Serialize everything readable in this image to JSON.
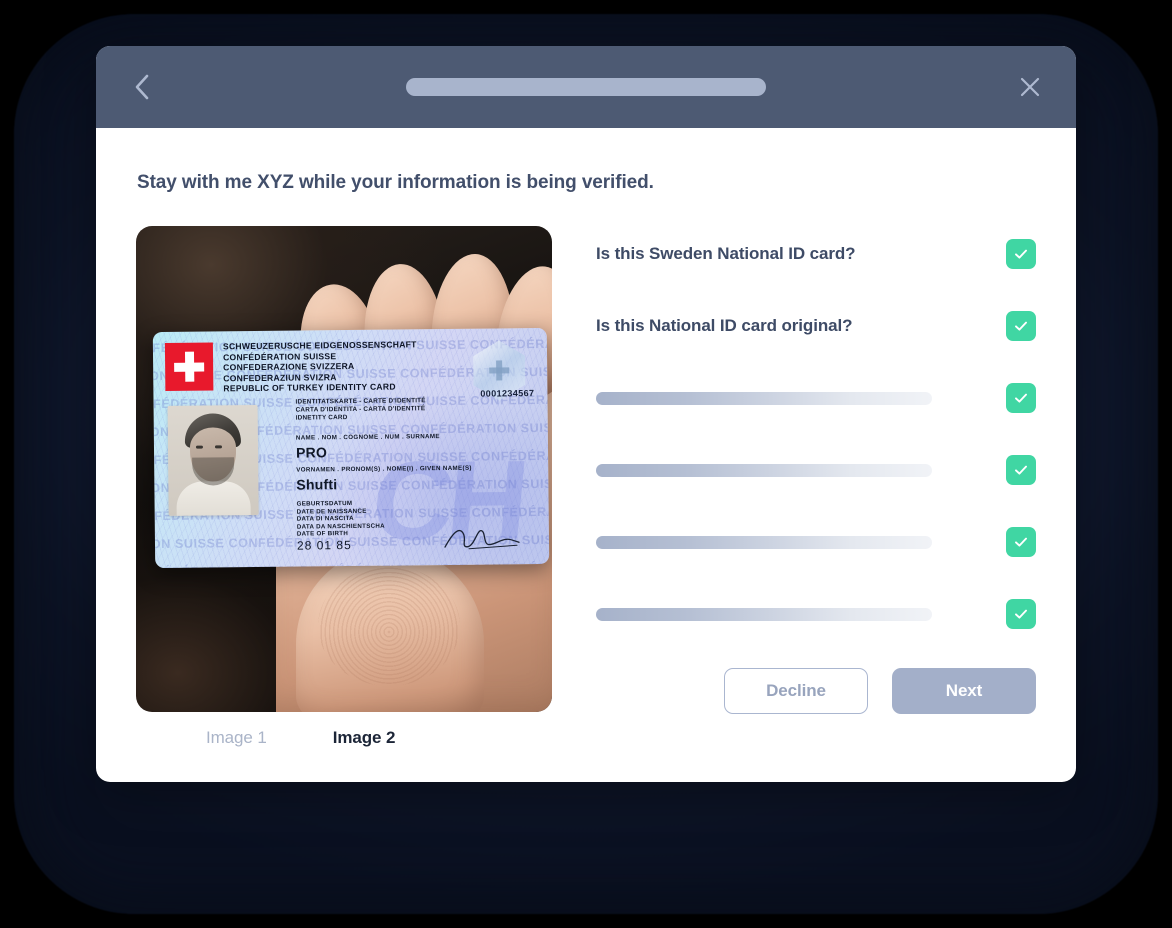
{
  "window": {
    "frame_color": "#131c33",
    "background_color": "#000000"
  },
  "header": {
    "back_icon": "chevron-left-icon",
    "close_icon": "close-x-icon",
    "bar_color": "#4d5a73",
    "progress_color": "#a8b4cc",
    "progress_value": ""
  },
  "main": {
    "headline": "Stay with me XYZ while your information is being verified."
  },
  "photo": {
    "alt": "Hand holding a national ID card",
    "card": {
      "titles": [
        "SCHWEUZERUSCHE EIDGENOSSENSCHAFT",
        "CONFÉDÉRATION SUISSE",
        "CONFEDERAZIONE SVIZZERA",
        "CONFEDERAZIUN SVIZRA",
        "REPUBLIC OF TURKEY IDENTITY CARD"
      ],
      "subtitles": [
        "IDENTITATSKARTE - CARTE D'IDENTITÉ",
        "CARTA D'IDENTITA - CARTA D'IDENTITÉ",
        "IDNETITY CARD"
      ],
      "serial": "0001234567",
      "surname_label": "NAME . NOM . COGNOME . NUM . SURNAME",
      "surname_value": "PRO",
      "given_label": "VORNAMEN .  PRONOM(S) .  NOME(I) .  GIVEN NAME(S)",
      "given_value": "Shufti",
      "dob_label": "GEBURTSDATUM\nDATE DE NAISSANCE\nDATA DI NASCITA\nDATA DA NASCHIENTSCHA\nDATE OF BIRTH",
      "dob_value": "28 01 85",
      "watermark_text": "CONFÉDÉRATION SUISSE   CONFÉDÉRATION SUISSE   CONFÉDÉRATION SUISSE   CONFÉ",
      "big_mark": "CH"
    }
  },
  "tabs": [
    {
      "label": "Image 1",
      "active": false
    },
    {
      "label": "Image 2",
      "active": true
    }
  ],
  "checks": [
    {
      "label": "Is this Sweden National ID card?",
      "type": "text",
      "checked": true
    },
    {
      "label": "Is this National ID card original?",
      "type": "text",
      "checked": true
    },
    {
      "label": "",
      "type": "skeleton",
      "checked": true
    },
    {
      "label": "",
      "type": "skeleton",
      "checked": true
    },
    {
      "label": "",
      "type": "skeleton",
      "checked": true
    },
    {
      "label": "",
      "type": "skeleton",
      "checked": true
    }
  ],
  "buttons": {
    "decline": "Decline",
    "next": "Next",
    "decline_color": "#98a4bd",
    "next_color": "#a3afc9"
  },
  "colors": {
    "check_green": "#40d6a3",
    "text_dark": "#3e4b66",
    "skeleton_start": "#a6b2ca"
  }
}
